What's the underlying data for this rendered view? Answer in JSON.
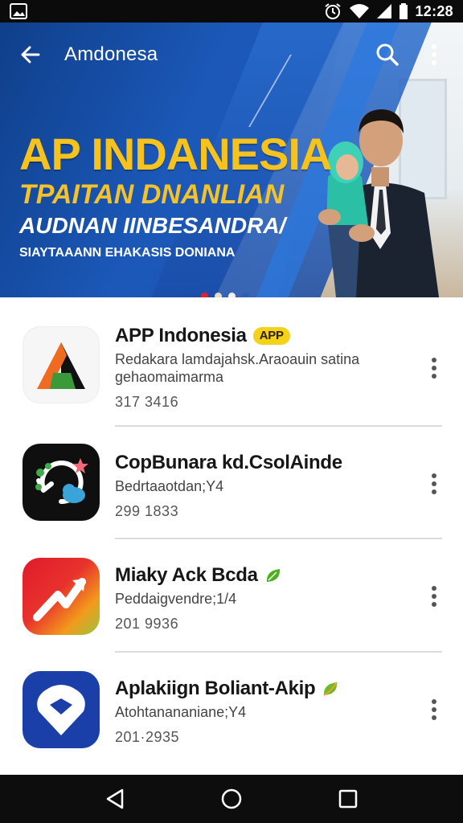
{
  "status_bar": {
    "time": "12:28",
    "icons": [
      "gallery-icon",
      "alarm-icon",
      "wifi-icon",
      "signal-icon",
      "battery-icon"
    ]
  },
  "header": {
    "title": "Amdonesa",
    "back_icon": "arrow-left-icon",
    "search_icon": "search-icon",
    "more_icon": "more-vert-icon"
  },
  "banner": {
    "title": "AP INDANESIA",
    "subtitle_1": "TPAITAN DNANLIAN",
    "subtitle_2": "AUDNAN IINBESANDRA/",
    "subtitle_3": "SIAYTAAANN EHAKASIS DONIANA",
    "carousel_pages": 4,
    "carousel_active": 1
  },
  "apps": [
    {
      "name": "APP Indonesia",
      "badge": "APP",
      "desc_line1": "Redakara lamdajahsk.Araoauin satina",
      "desc_line2": "gehaomaimarma",
      "stat": "317 3416",
      "icon": "triangle-logo-icon"
    },
    {
      "name": "CopBunara kd.CsolAinde",
      "badge": "",
      "desc_line1": "Bedrtaaotdan;Y4",
      "desc_line2": "",
      "stat": "299 1833",
      "icon": "refresh-cloud-icon"
    },
    {
      "name": "Miaky Ack Bcda",
      "badge": "",
      "desc_line1": "Peddaigvendre;1/4",
      "desc_line2": "",
      "stat": "201 9936",
      "icon": "trending-arrow-icon"
    },
    {
      "name": "Aplakiign Boliant-Akip",
      "badge": "",
      "desc_line1": "Atohtanananiane;Y4",
      "desc_line2": "",
      "stat": "201·2935",
      "icon": "location-pin-icon"
    }
  ],
  "colors": {
    "banner_blue": "#1b58b8",
    "promo_yellow": "#f6c21d",
    "badge_yellow": "#f5d21a",
    "leaf_green": "#4caf1e",
    "divider": "#dcdcdc"
  }
}
